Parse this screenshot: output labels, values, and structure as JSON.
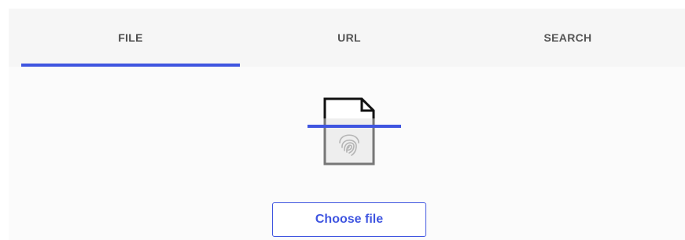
{
  "tabs": [
    {
      "label": "FILE",
      "active": true
    },
    {
      "label": "URL",
      "active": false
    },
    {
      "label": "SEARCH",
      "active": false
    }
  ],
  "upload": {
    "icon": "file-fingerprint-scan-icon",
    "choose_label": "Choose file"
  },
  "colors": {
    "accent": "#3f55e0",
    "tab_bar": "#f6f6f6",
    "tab_text": "#555555",
    "panel": "#fbfbfb"
  }
}
